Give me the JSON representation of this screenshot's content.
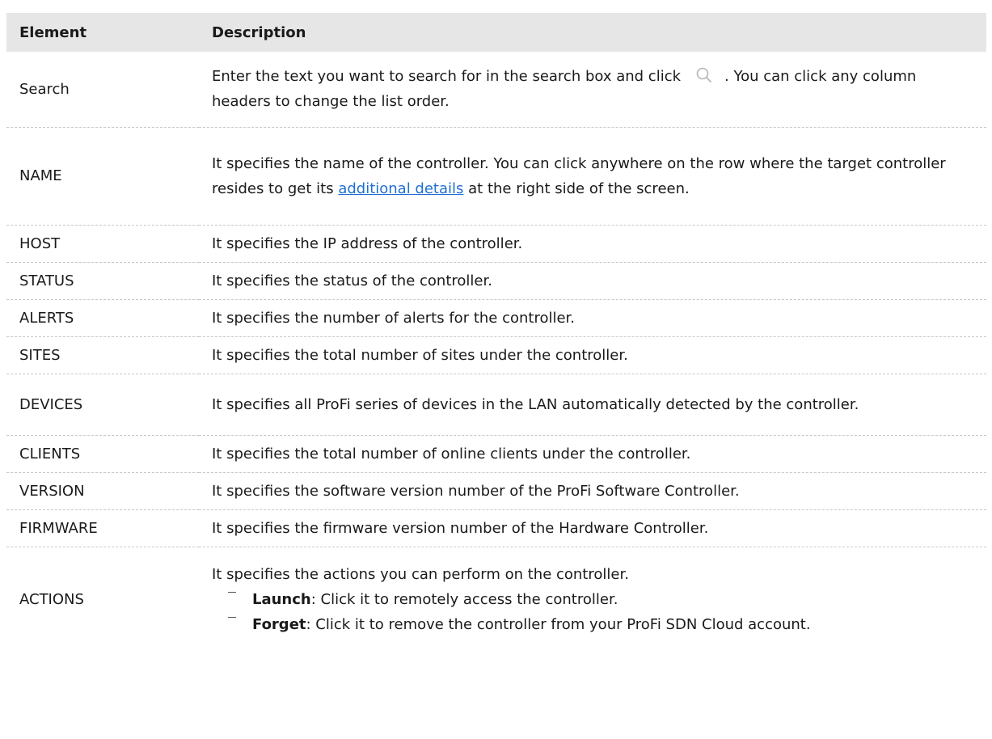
{
  "header": {
    "col1": "Element",
    "col2": "Description"
  },
  "rows": [
    {
      "element": "Search",
      "desc_a": "Enter the text you want to search for in the search box and click",
      "desc_b": ". You can click any column headers to change the list order.",
      "icon": "search-icon"
    },
    {
      "element": "NAME",
      "desc_a": "It specifies the name of the controller. You can click anywhere on the row where the target controller resides to get its",
      "link": "additional details",
      "desc_b": "at the right side of the screen."
    },
    {
      "element": "HOST",
      "desc": "It specifies the IP address of the controller."
    },
    {
      "element": "STATUS",
      "desc": "It specifies the status of the controller."
    },
    {
      "element": "ALERTS",
      "desc": "It specifies the number of alerts for the controller."
    },
    {
      "element": "SITES",
      "desc": "It specifies the total number of sites under the controller."
    },
    {
      "element": "DEVICES",
      "desc": "It specifies all ProFi series of devices in the LAN automatically detected by the controller."
    },
    {
      "element": "CLIENTS",
      "desc": "It specifies the total number of online clients under the controller."
    },
    {
      "element": "VERSION",
      "desc": "It specifies the software version number of the ProFi Software Controller."
    },
    {
      "element": "FIRMWARE",
      "desc": "It specifies the firmware version number of the Hardware Controller."
    },
    {
      "element": "ACTIONS",
      "desc": "It specifies the actions you can perform on the controller.",
      "bullets": [
        {
          "term": "Launch",
          "text": ": Click it to remotely access the controller."
        },
        {
          "term": "Forget",
          "text": ": Click it to remove the controller from your ProFi SDN Cloud account."
        }
      ]
    }
  ],
  "colors": {
    "header_bg": "#e6e6e6",
    "link": "#1f6fd1",
    "divider": "#c8c8c8"
  }
}
